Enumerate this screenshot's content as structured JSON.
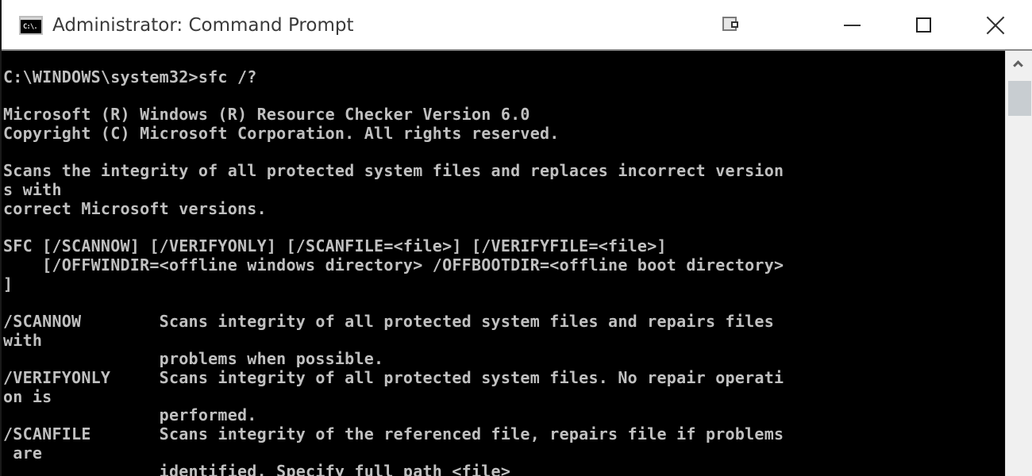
{
  "window": {
    "title": "Administrator: Command Prompt",
    "app_icon_label": "C:\\.",
    "icons": {
      "app": "cmd-icon",
      "snap": "snap-assist-icon",
      "minimize": "minimize-icon",
      "maximize": "maximize-icon",
      "close": "close-icon",
      "scroll_up": "chevron-up-icon"
    }
  },
  "console": {
    "background": "#000000",
    "foreground": "#c0c0c0",
    "lines": [
      "C:\\WINDOWS\\system32>sfc /?",
      "",
      "Microsoft (R) Windows (R) Resource Checker Version 6.0",
      "Copyright (C) Microsoft Corporation. All rights reserved.",
      "",
      "Scans the integrity of all protected system files and replaces incorrect version",
      "s with",
      "correct Microsoft versions.",
      "",
      "SFC [/SCANNOW] [/VERIFYONLY] [/SCANFILE=<file>] [/VERIFYFILE=<file>]",
      "    [/OFFWINDIR=<offline windows directory> /OFFBOOTDIR=<offline boot directory>",
      "]",
      "",
      "/SCANNOW        Scans integrity of all protected system files and repairs files",
      "with",
      "                problems when possible.",
      "/VERIFYONLY     Scans integrity of all protected system files. No repair operati",
      "on is",
      "                performed.",
      "/SCANFILE       Scans integrity of the referenced file, repairs file if problems",
      " are",
      "                identified. Specify full path <file>"
    ]
  },
  "scrollbar": {
    "track_color": "#f0f0f0",
    "thumb_color": "#c8cdd1"
  }
}
